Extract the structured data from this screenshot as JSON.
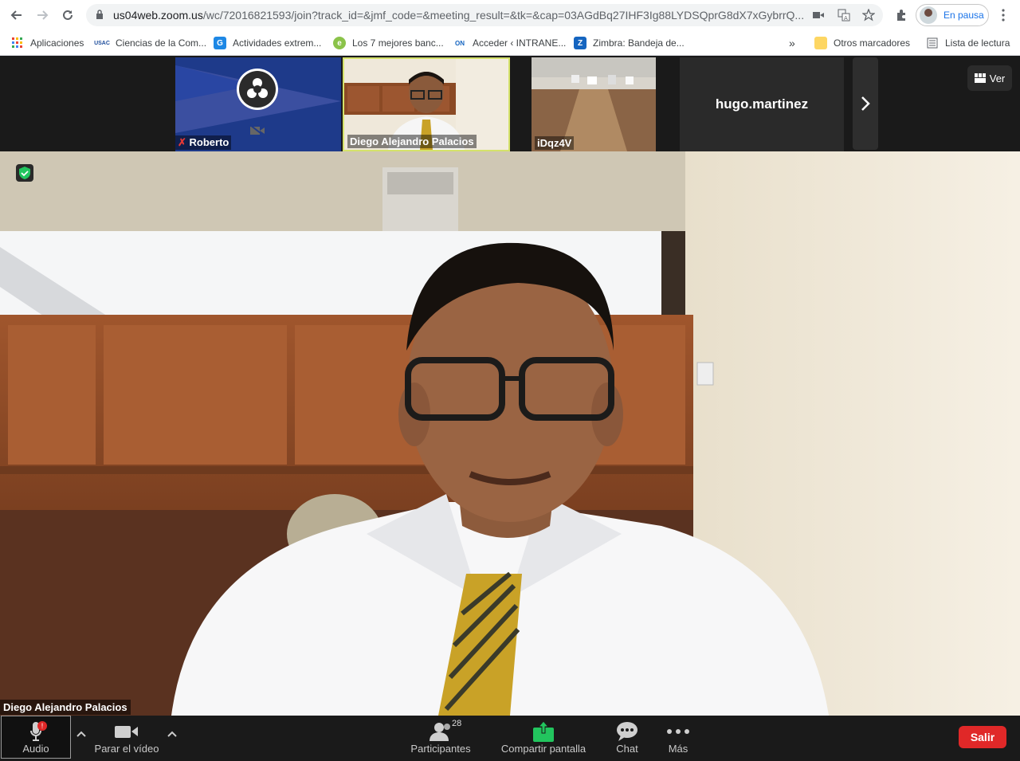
{
  "browser": {
    "url_host": "us04web.zoom.us",
    "url_path": "/wc/72016821593/join?track_id=&jmf_code=&meeting_result=&tk=&cap=03AGdBq27IHF3Ig88LYDSQprG8dX7xGybrrQ...",
    "profile_label": "En pausa",
    "bookmarks": [
      {
        "label": "Aplicaciones",
        "icon": "apps-grid-icon"
      },
      {
        "label": "Ciencias de la Com...",
        "icon": "usac-icon"
      },
      {
        "label": "Actividades extrem...",
        "icon": "g-icon"
      },
      {
        "label": "Los 7 mejores banc...",
        "icon": "e-icon"
      },
      {
        "label": "Acceder ‹ INTRANE...",
        "icon": "on-icon"
      },
      {
        "label": "Zimbra: Bandeja de...",
        "icon": "zimbra-icon"
      }
    ],
    "bookmarks_overflow": "»",
    "other_bookmarks": "Otros marcadores",
    "reading_list": "Lista de lectura"
  },
  "meeting": {
    "thumbnails": [
      {
        "name": "Roberto",
        "muted": true,
        "video_off": true
      },
      {
        "name": "Diego Alejandro Palacios",
        "active_speaker": true
      },
      {
        "name": "iDqz4V"
      },
      {
        "name": "hugo.martinez",
        "no_video": true
      }
    ],
    "view_label": "Ver",
    "active_speaker": "Diego Alejandro Palacios"
  },
  "footer": {
    "audio_label": "Audio",
    "audio_badge": "!",
    "video_label": "Parar el vídeo",
    "participants_label": "Participantes",
    "participants_count": "28",
    "share_label": "Compartir pantalla",
    "chat_label": "Chat",
    "more_label": "Más",
    "leave_label": "Salir"
  },
  "colors": {
    "leave": "#e02828",
    "share": "#22c55e",
    "active_border": "#d5e26a"
  }
}
